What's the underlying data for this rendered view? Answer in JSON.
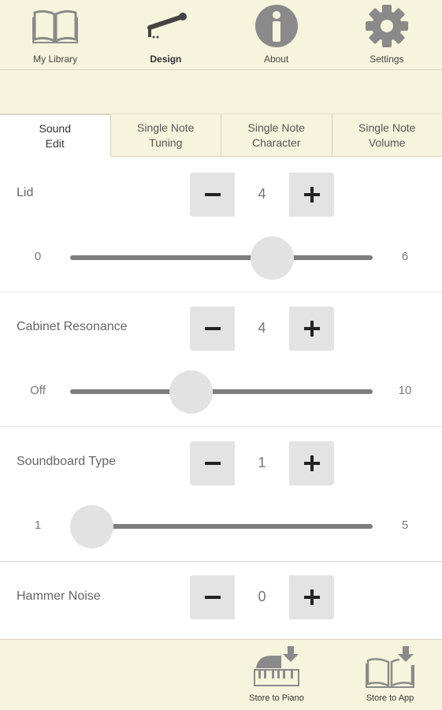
{
  "nav": {
    "items": [
      {
        "label": "My Library",
        "icon": "book-icon"
      },
      {
        "label": "Design",
        "icon": "design-pen-icon",
        "active": true
      },
      {
        "label": "About",
        "icon": "info-icon"
      },
      {
        "label": "Settings",
        "icon": "gear-icon"
      }
    ]
  },
  "tabs": [
    {
      "label": "Sound\nEdit",
      "active": true
    },
    {
      "label": "Single Note\nTuning"
    },
    {
      "label": "Single Note\nCharacter"
    },
    {
      "label": "Single Note\nVolume"
    }
  ],
  "settings": [
    {
      "label": "Lid",
      "value": "4",
      "min_label": "0",
      "max_label": "6",
      "min": 0,
      "max": 6,
      "level": 4
    },
    {
      "label": "Cabinet Resonance",
      "value": "4",
      "min_label": "Off",
      "max_label": "10",
      "min": 0,
      "max": 10,
      "level": 4
    },
    {
      "label": "Soundboard Type",
      "value": "1",
      "min_label": "1",
      "max_label": "5",
      "min": 1,
      "max": 5,
      "level": 1
    },
    {
      "label": "Hammer Noise",
      "value": "0"
    }
  ],
  "bottom": {
    "store_piano": "Store to Piano",
    "store_app": "Store to App"
  },
  "colors": {
    "bar_background": "#f7f4dd",
    "icon_gray": "#8a8a8a",
    "button_gray": "#e3e3e3",
    "track": "#7d7d7d"
  }
}
